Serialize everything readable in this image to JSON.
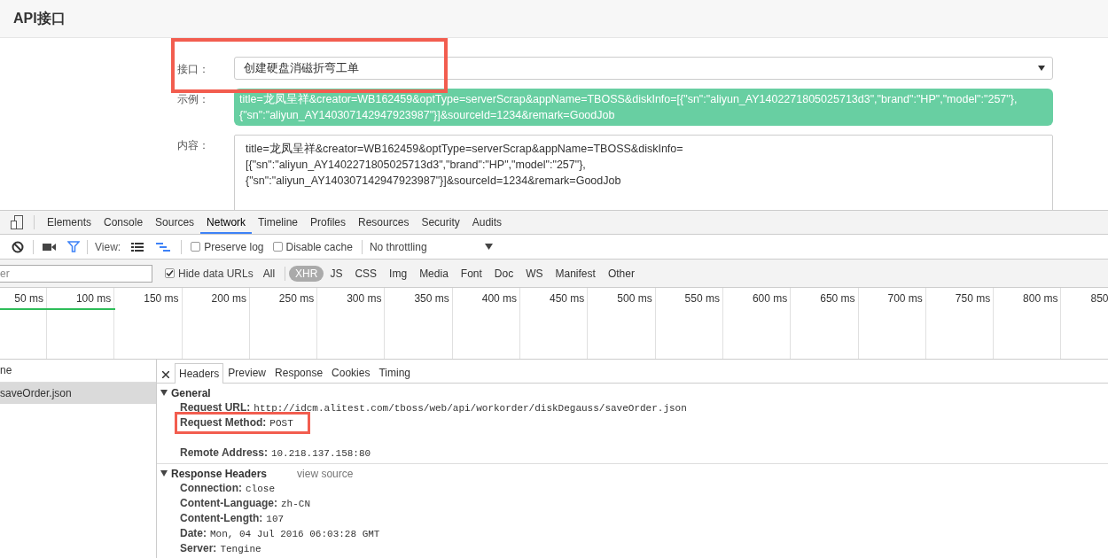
{
  "page": {
    "title": "API接口",
    "fields": [
      {
        "label": "接口：",
        "kind": "select",
        "value": "创建硬盘消磁折弯工单"
      },
      {
        "label": "示例：",
        "kind": "example",
        "value": "title=龙凤呈祥&creator=WB162459&optType=serverScrap&appName=TBOSS&diskInfo=[{\"sn\":\"aliyun_AY1402271805025713d3\",\"brand\":\"HP\",\"model\":\"257\"},\n{\"sn\":\"aliyun_AY140307142947923987\"}]&sourceId=1234&remark=GoodJob"
      },
      {
        "label": "内容：",
        "kind": "textarea",
        "value": "title=龙凤呈祥&creator=WB162459&optType=serverScrap&appName=TBOSS&diskInfo=\n[{\"sn\":\"aliyun_AY1402271805025713d3\",\"brand\":\"HP\",\"model\":\"257\"},\n{\"sn\":\"aliyun_AY140307142947923987\"}]&sourceId=1234&remark=GoodJob"
      }
    ]
  },
  "devtools": {
    "tabs": [
      {
        "label": "Elements",
        "selected": false
      },
      {
        "label": "Console",
        "selected": false
      },
      {
        "label": "Sources",
        "selected": false
      },
      {
        "label": "Network",
        "selected": true
      },
      {
        "label": "Timeline",
        "selected": false
      },
      {
        "label": "Profiles",
        "selected": false
      },
      {
        "label": "Resources",
        "selected": false
      },
      {
        "label": "Security",
        "selected": false
      },
      {
        "label": "Audits",
        "selected": false
      }
    ],
    "toolbar": {
      "view_label": "View:",
      "preserve_log": {
        "label": "Preserve log",
        "checked": false
      },
      "disable_cache": {
        "label": "Disable cache",
        "checked": false
      },
      "throttling": "No throttling"
    },
    "filter": {
      "placeholder": "er",
      "hide_data_urls": {
        "label": "Hide data URLs",
        "checked": true
      },
      "types": [
        {
          "label": "All",
          "selected": false
        },
        {
          "label": "XHR",
          "selected": true
        },
        {
          "label": "JS",
          "selected": false
        },
        {
          "label": "CSS",
          "selected": false
        },
        {
          "label": "Img",
          "selected": false
        },
        {
          "label": "Media",
          "selected": false
        },
        {
          "label": "Font",
          "selected": false
        },
        {
          "label": "Doc",
          "selected": false
        },
        {
          "label": "WS",
          "selected": false
        },
        {
          "label": "Manifest",
          "selected": false
        },
        {
          "label": "Other",
          "selected": false
        }
      ]
    },
    "timeline_ticks": [
      "50 ms",
      "100 ms",
      "150 ms",
      "200 ms",
      "250 ms",
      "300 ms",
      "350 ms",
      "400 ms",
      "450 ms",
      "500 ms",
      "550 ms",
      "600 ms",
      "650 ms",
      "700 ms",
      "750 ms",
      "800 ms",
      "850"
    ],
    "requests": {
      "header": "ne",
      "rows": [
        {
          "name": "saveOrder.json",
          "selected": true
        }
      ]
    },
    "detail_tabs": [
      {
        "label": "Headers",
        "selected": true
      },
      {
        "label": "Preview",
        "selected": false
      },
      {
        "label": "Response",
        "selected": false
      },
      {
        "label": "Cookies",
        "selected": false
      },
      {
        "label": "Timing",
        "selected": false
      }
    ],
    "sections": [
      {
        "title": "General",
        "expanded": true,
        "rows": [
          {
            "name": "Request URL:",
            "value": "http://idcm.alitest.com/tboss/web/api/workorder/diskDegauss/saveOrder.json"
          },
          {
            "name": "Request Method:",
            "value": "POST"
          },
          {
            "name": "Remote Address:",
            "value": "10.218.137.158:80"
          }
        ]
      },
      {
        "title": "Response Headers",
        "expanded": true,
        "link": "view source",
        "rows": [
          {
            "name": "Connection:",
            "value": "close"
          },
          {
            "name": "Content-Language:",
            "value": "zh-CN"
          },
          {
            "name": "Content-Length:",
            "value": "107"
          },
          {
            "name": "Date:",
            "value": "Mon, 04 Jul 2016 06:03:28 GMT"
          },
          {
            "name": "Server:",
            "value": "Tengine"
          }
        ]
      }
    ]
  }
}
